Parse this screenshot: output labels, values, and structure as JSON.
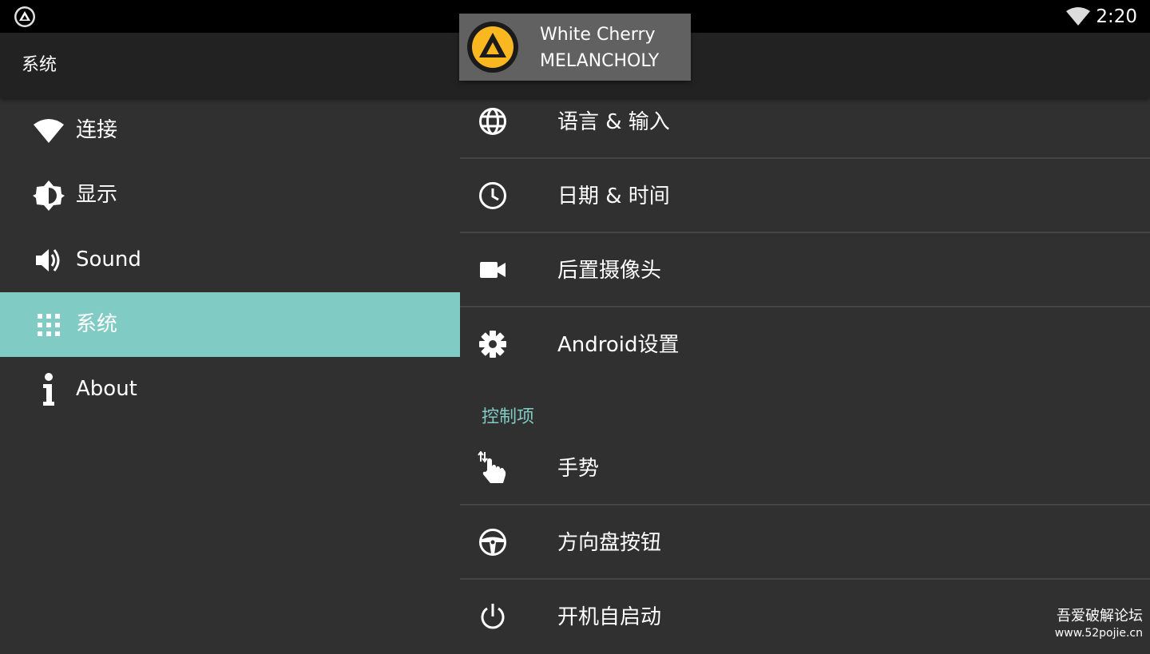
{
  "status_bar": {
    "time": "2:20",
    "app_icon": "aimp-logo-icon",
    "wifi_icon": "wifi-icon"
  },
  "toolbar": {
    "title": "系统"
  },
  "sidebar": {
    "items": [
      {
        "label": "连接",
        "icon": "wifi-icon",
        "selected": false
      },
      {
        "label": "显示",
        "icon": "brightness-icon",
        "selected": false
      },
      {
        "label": "Sound",
        "icon": "volume-icon",
        "selected": false
      },
      {
        "label": "系统",
        "icon": "apps-grid-icon",
        "selected": true
      },
      {
        "label": "About",
        "icon": "info-icon",
        "selected": false
      }
    ]
  },
  "content": {
    "items": [
      {
        "label": "语言 & 输入",
        "icon": "globe-icon"
      },
      {
        "label": "日期 & 时间",
        "icon": "clock-icon"
      },
      {
        "label": "后置摄像头",
        "icon": "camera-icon"
      },
      {
        "label": "Android设置",
        "icon": "gear-icon"
      }
    ],
    "section_header": "控制项",
    "controls": [
      {
        "label": "手势",
        "icon": "gesture-hand-icon"
      },
      {
        "label": "方向盘按钮",
        "icon": "steering-wheel-icon"
      },
      {
        "label": "开机自启动",
        "icon": "power-icon"
      }
    ]
  },
  "now_playing": {
    "title": "White Cherry",
    "artist": "MELANCHOLY",
    "art_icon": "aimp-logo-icon"
  },
  "watermark": {
    "line1": "吾爱破解论坛",
    "line2": "www.52pojie.cn"
  },
  "colors": {
    "accent": "#80cbc4",
    "background": "#303030",
    "toolbar": "#222222",
    "status_bar": "#000000",
    "toast": "#616161"
  }
}
